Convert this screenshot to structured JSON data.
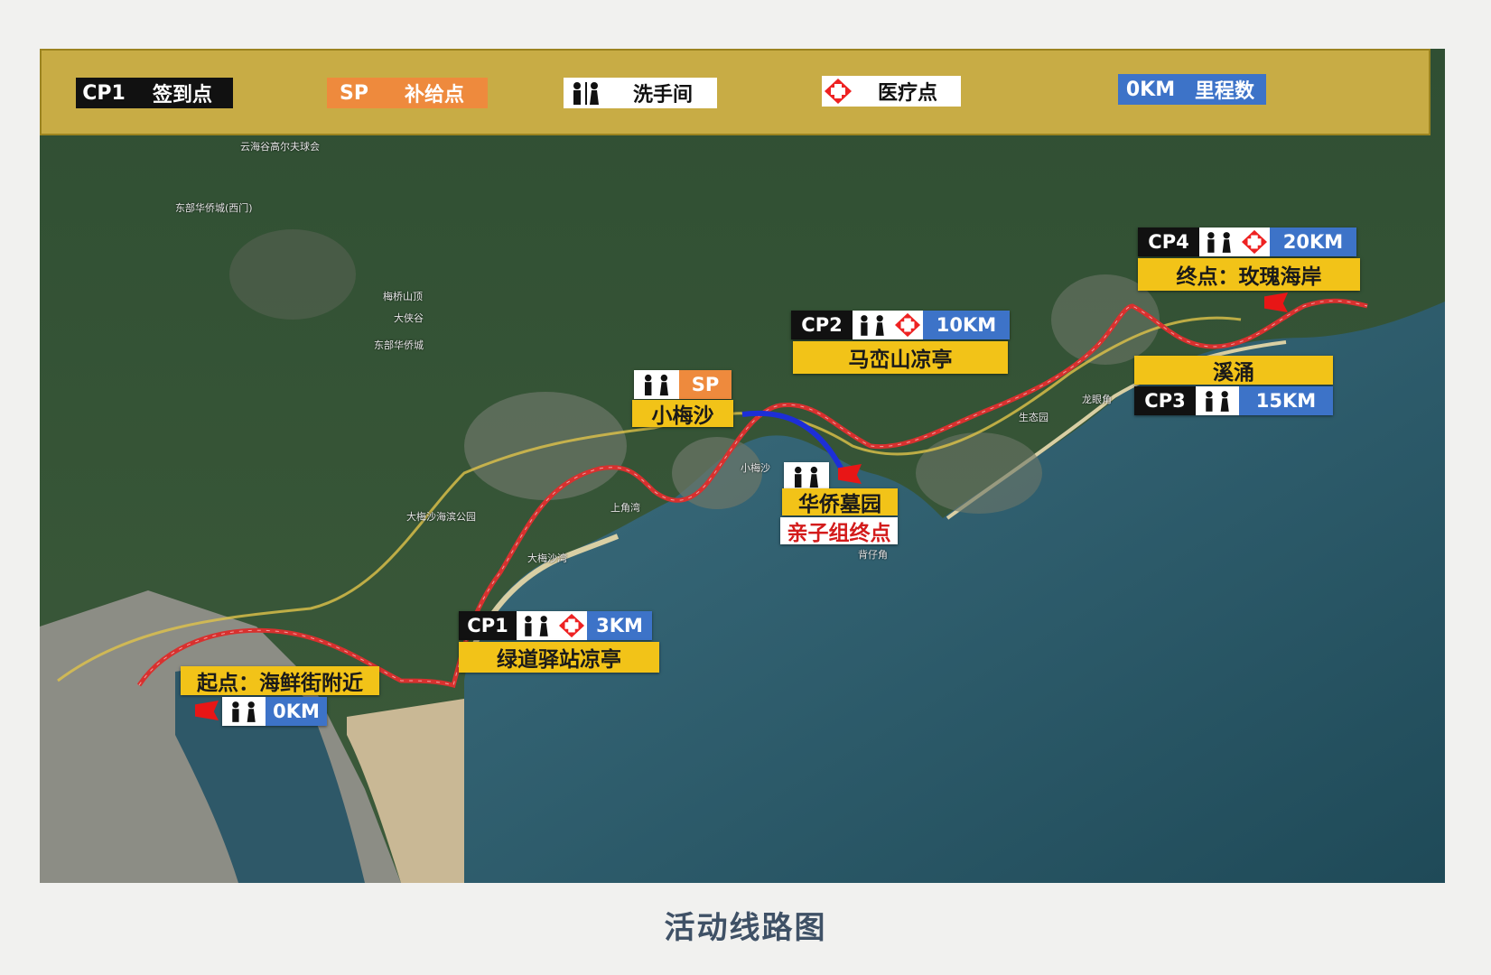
{
  "legend": {
    "checkin": {
      "code": "CP1",
      "label": "签到点"
    },
    "supply": {
      "code": "SP",
      "label": "补给点"
    },
    "toilet": {
      "icon": "toilet-icon",
      "label": "洗手间"
    },
    "medical": {
      "icon": "medical-cross-icon",
      "label": "医疗点"
    },
    "distance": {
      "code": "0KM",
      "label": "里程数"
    }
  },
  "checkpoints": [
    {
      "code": "CP1",
      "km": "3KM",
      "name": "绿道驿站凉亭",
      "icons": [
        "toilet-icon",
        "medical-cross-icon"
      ]
    },
    {
      "code": "CP2",
      "km": "10KM",
      "name": "马峦山凉亭",
      "icons": [
        "toilet-icon",
        "medical-cross-icon"
      ]
    },
    {
      "code": "CP3",
      "km": "15KM",
      "name": "溪涌",
      "icons": [
        "toilet-icon"
      ]
    },
    {
      "code": "CP4",
      "km": "20KM",
      "name": "终点：玫瑰海岸",
      "icons": [
        "toilet-icon",
        "medical-cross-icon"
      ]
    }
  ],
  "start": {
    "name": "起点：海鲜街附近",
    "km": "0KM",
    "icons": [
      "toilet-icon"
    ]
  },
  "supply_stop": {
    "code": "SP",
    "name": "小梅沙",
    "icons": [
      "toilet-icon"
    ]
  },
  "family_finish": {
    "name": "华侨墓园",
    "note": "亲子组终点",
    "icons": [
      "toilet-icon"
    ]
  },
  "map_places": {
    "p1": "云海谷高尔夫球会",
    "p2": "东部华侨城(西门)",
    "p3": "梅桥山顶",
    "p4": "大侠谷",
    "p5": "东部华侨城",
    "p6": "大梅沙海滨公园",
    "p7": "大梅沙湾",
    "p8": "上角湾",
    "p9": "小梅沙",
    "p10": "背仔角",
    "p11": "生态园",
    "p12": "龙眼角"
  },
  "colors": {
    "route": "#d8312f",
    "family_route": "#1d2fd6",
    "legend_bg": "#c8ac45",
    "name_bar": "#f2c318",
    "distance_box": "#3d73c8",
    "supply_box": "#ee8a3d"
  },
  "caption": "活动线路图"
}
